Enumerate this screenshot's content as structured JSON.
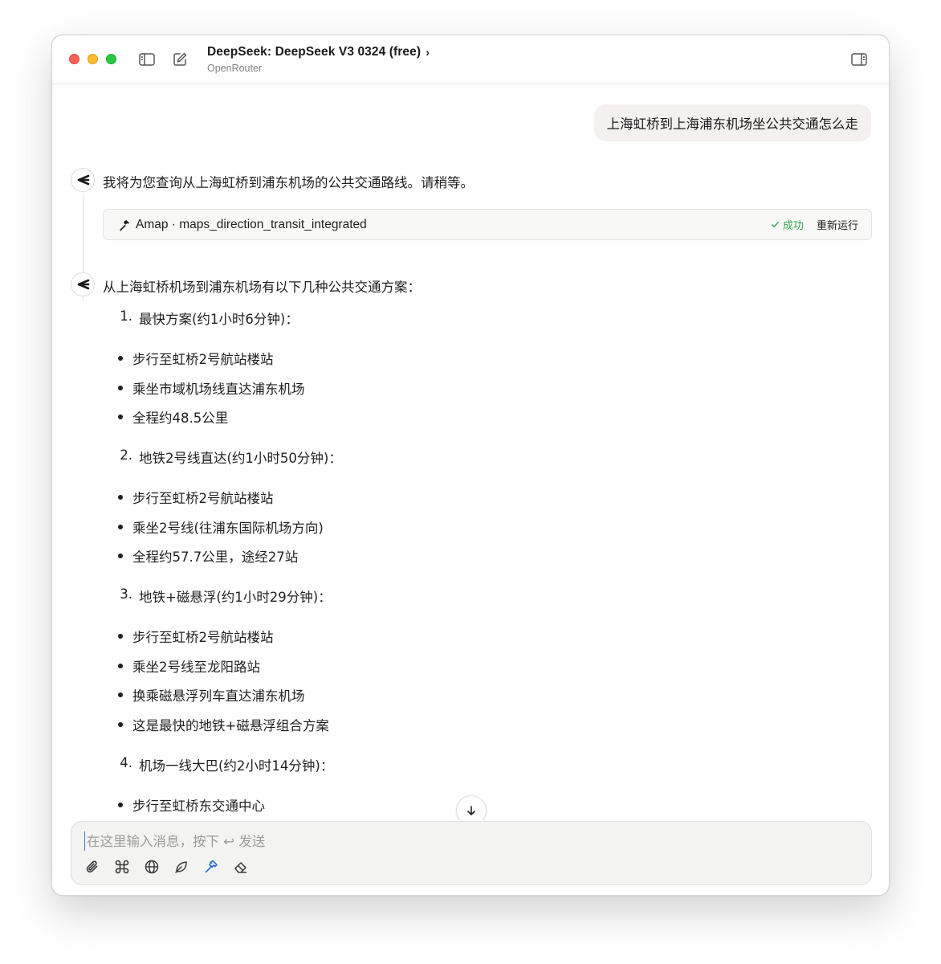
{
  "window": {
    "title": "DeepSeek: DeepSeek V3 0324 (free)",
    "title_chevron": "›",
    "subtitle": "OpenRouter"
  },
  "conversation": {
    "user_message": "上海虹桥到上海浦东机场坐公共交通怎么走",
    "assistant_intro": "我将为您查询从上海虹桥到浦东机场的公共交通路线。请稍等。",
    "tool_call": {
      "name": "Amap · maps_direction_transit_integrated",
      "status": "成功",
      "rerun_label": "重新运行"
    },
    "answer_intro": "从上海虹桥机场到浦东机场有以下几种公共交通方案：",
    "plans": [
      {
        "num": "1.",
        "title": "最快方案(约1小时6分钟)：",
        "bullets": [
          "步行至虹桥2号航站楼站",
          "乘坐市域机场线直达浦东机场",
          "全程约48.5公里"
        ]
      },
      {
        "num": "2.",
        "title": "地铁2号线直达(约1小时50分钟)：",
        "bullets": [
          "步行至虹桥2号航站楼站",
          "乘坐2号线(往浦东国际机场方向)",
          "全程约57.7公里，途经27站"
        ]
      },
      {
        "num": "3.",
        "title": "地铁+磁悬浮(约1小时29分钟)：",
        "bullets": [
          "步行至虹桥2号航站楼站",
          "乘坐2号线至龙阳路站",
          "换乘磁悬浮列车直达浦东机场",
          "这是最快的地铁+磁悬浮组合方案"
        ]
      },
      {
        "num": "4.",
        "title": "机场一线大巴(约2小时14分钟)：",
        "bullets": [
          "步行至虹桥东交通中心"
        ]
      }
    ]
  },
  "composer": {
    "placeholder": "在这里输入消息，按下 ↩ 发送",
    "tools": [
      "paperclip-icon",
      "command-icon",
      "globe-icon",
      "leaf-icon",
      "hammer-icon",
      "eraser-icon"
    ]
  },
  "colors": {
    "success": "#36a852",
    "active_tool": "#2f6fd6",
    "user_bubble": "#f3f0ef"
  }
}
